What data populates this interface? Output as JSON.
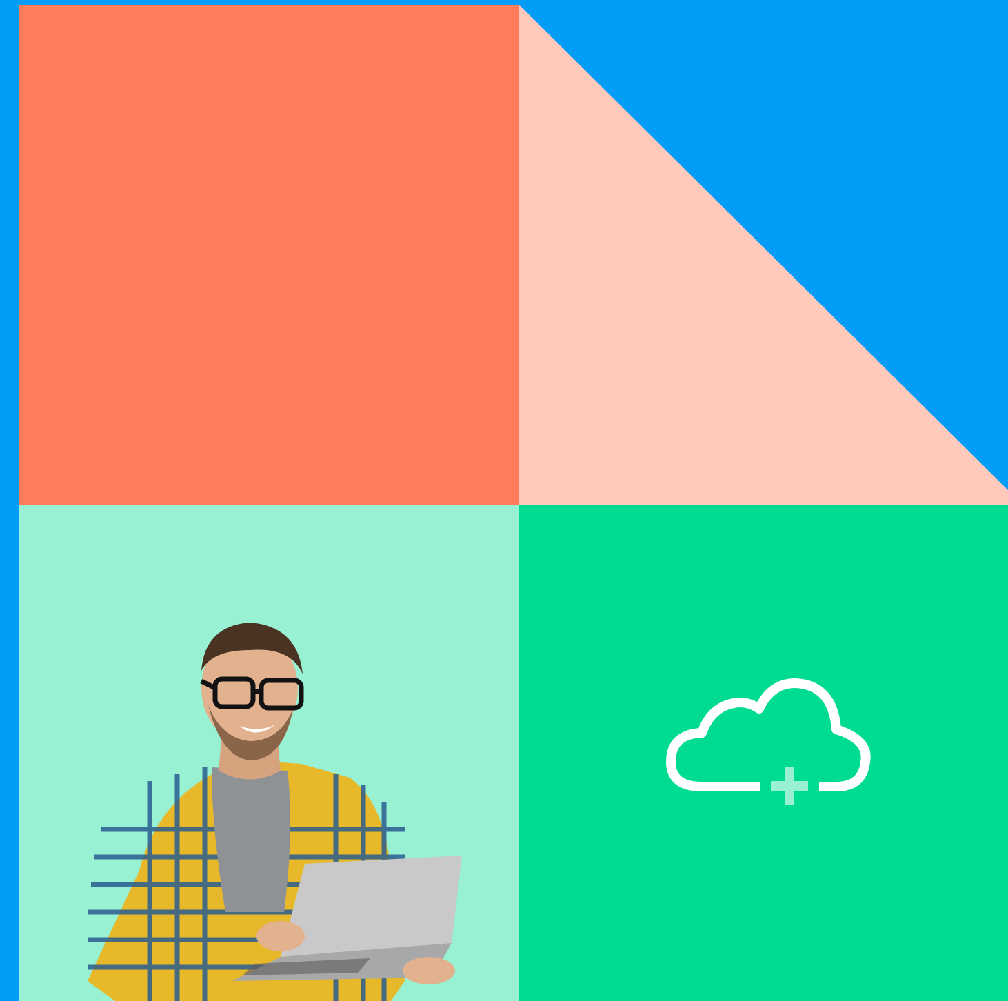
{
  "colors": {
    "background_blue": "#039cf7",
    "coral": "#ff7c5a",
    "peach": "#ffc9bb",
    "mint": "#98f1d3",
    "green": "#00dc8f",
    "white": "#ffffff"
  },
  "icons": {
    "cloud": "cloud-plus-icon"
  },
  "illustration": {
    "subject": "person-with-laptop"
  }
}
